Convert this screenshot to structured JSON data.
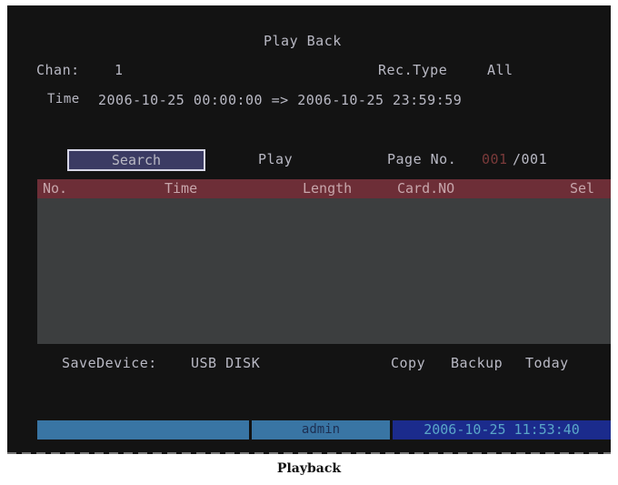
{
  "screen": {
    "title": "Play Back",
    "chan_label": "Chan:",
    "chan_value": "1",
    "rec_type_label": "Rec.Type",
    "rec_type_value": "All",
    "time_label": "Time",
    "time_value": "2006-10-25 00:00:00 => 2006-10-25 23:59:59"
  },
  "actions": {
    "search_label": "Search",
    "play_label": "Play",
    "page_label": "Page No.",
    "page_current": "001",
    "page_total": "/001"
  },
  "table": {
    "columns": [
      "No.",
      "Time",
      "Length",
      "Card.NO",
      "Sel"
    ],
    "rows": []
  },
  "footer": {
    "save_device_label": "SaveDevice:",
    "save_device_value": "USB DISK",
    "copy_label": "Copy",
    "backup_label": "Backup",
    "today_label": "Today"
  },
  "status": {
    "user": "admin",
    "datetime": "2006-10-25 11:53:40"
  },
  "caption": "Playback",
  "colors": {
    "screen_bg": "#131313",
    "header_bg": "#6d2e37",
    "table_bg": "#3c3e3f",
    "status_bg": "#3975a4",
    "clock_bg": "#1b2b8c"
  }
}
